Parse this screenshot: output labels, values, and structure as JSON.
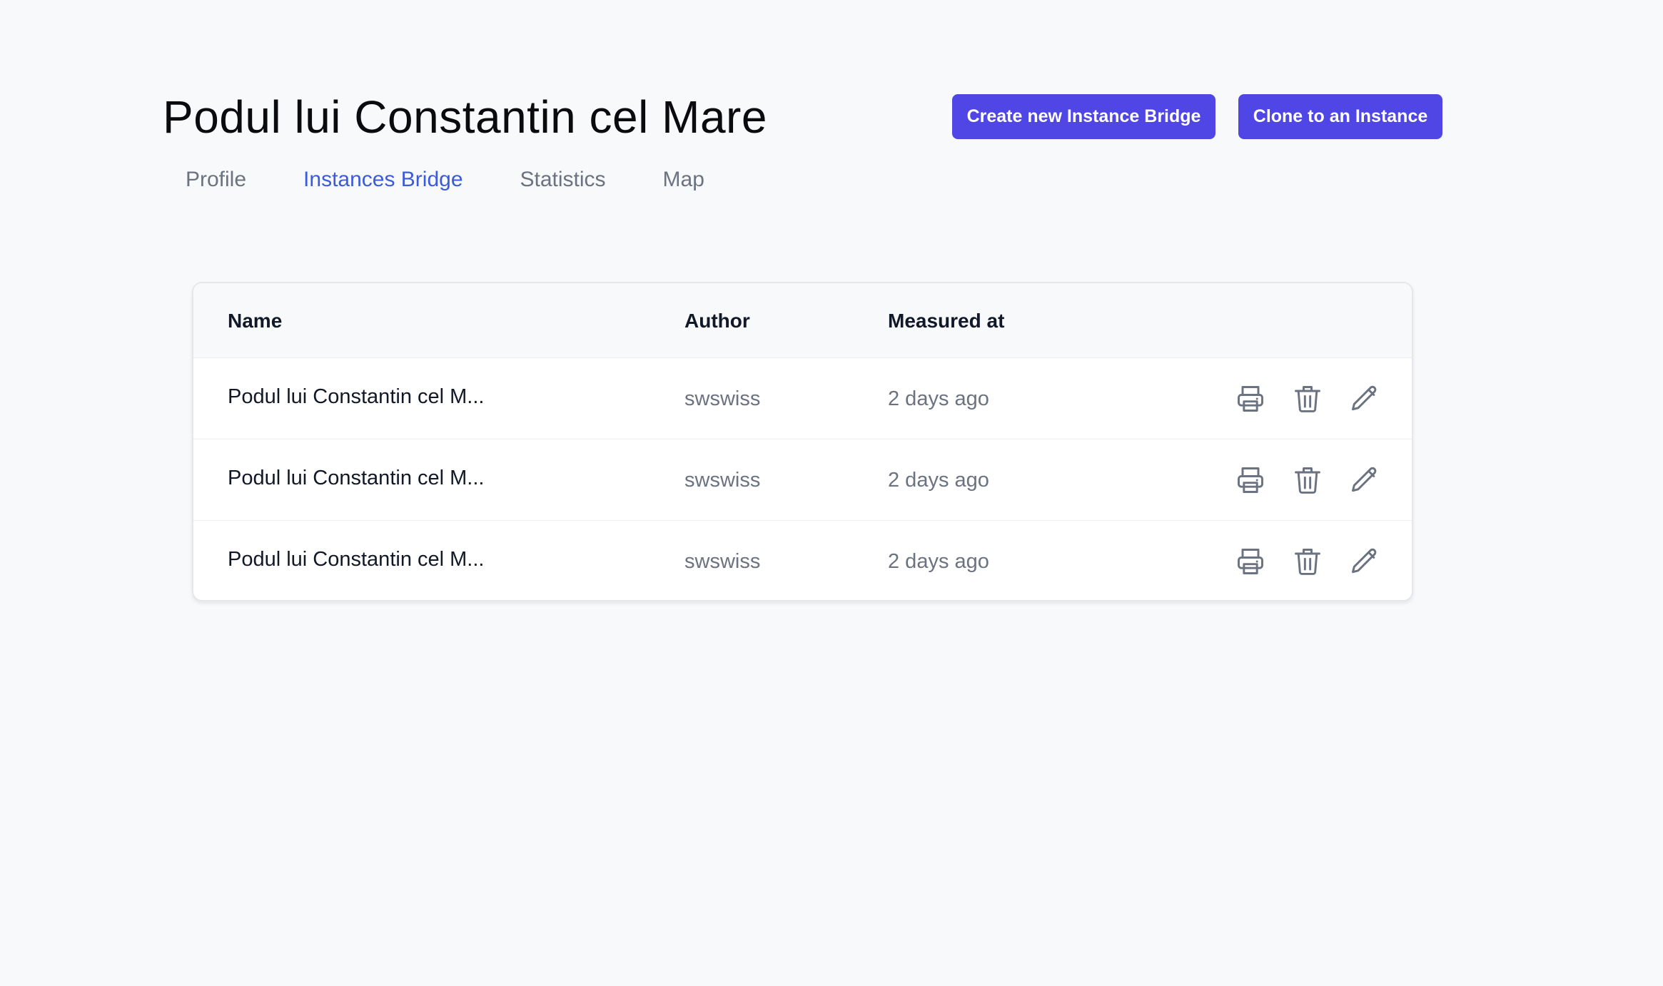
{
  "page": {
    "title": "Podul lui Constantin cel Mare"
  },
  "header_actions": {
    "create_label": "Create new Instance Bridge",
    "clone_label": "Clone to an Instance"
  },
  "tabs": [
    {
      "label": "Profile",
      "active": false
    },
    {
      "label": "Instances Bridge",
      "active": true
    },
    {
      "label": "Statistics",
      "active": false
    },
    {
      "label": "Map",
      "active": false
    }
  ],
  "table": {
    "columns": [
      "Name",
      "Author",
      "Measured at"
    ],
    "rows": [
      {
        "name": "Podul lui Constantin cel M...",
        "author": "swswiss",
        "measured_at": "2 days ago"
      },
      {
        "name": "Podul lui Constantin cel M...",
        "author": "swswiss",
        "measured_at": "2 days ago"
      },
      {
        "name": "Podul lui Constantin cel M...",
        "author": "swswiss",
        "measured_at": "2 days ago"
      }
    ],
    "row_icons": [
      "printer-icon",
      "trash-icon",
      "pencil-icon"
    ]
  },
  "colors": {
    "accent": "#4f46e5",
    "active_tab": "#3b5bdb",
    "muted_text": "#6b7280",
    "background": "#f8f9fb"
  }
}
